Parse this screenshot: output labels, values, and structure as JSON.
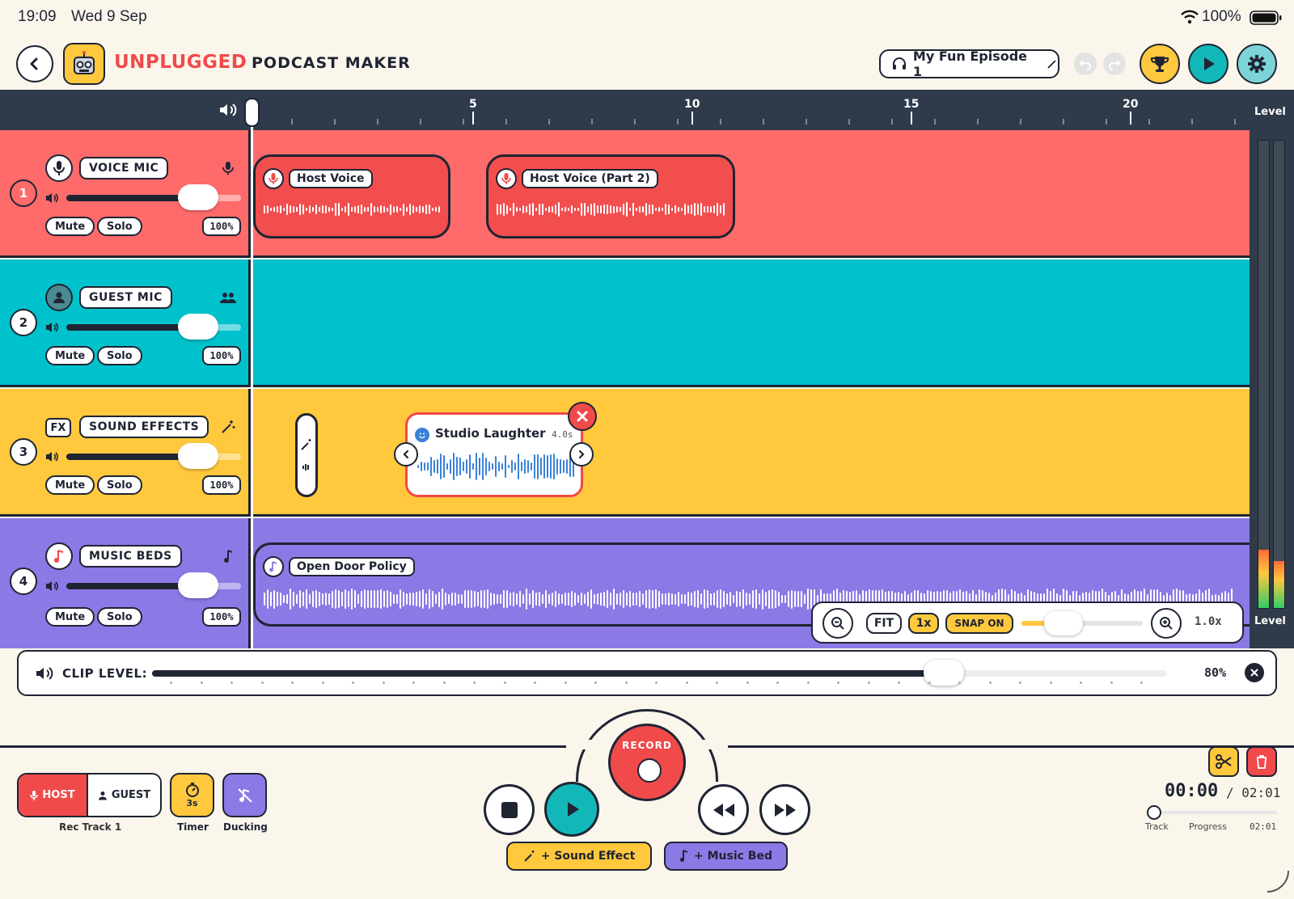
{
  "status_bar": {
    "time": "19:09",
    "date": "Wed 9 Sep",
    "battery": "100%"
  },
  "header": {
    "brand_primary": "UNPLUGGED",
    "brand_secondary": "PODCAST MAKER",
    "episode_title": "My Fun Episode 1"
  },
  "ruler": {
    "labels": [
      "5",
      "10",
      "15",
      "20"
    ]
  },
  "level_meter": {
    "top_label": "Level",
    "bottom_label": "Level"
  },
  "tracks": [
    {
      "number": "1",
      "label": "VOICE MIC",
      "mute": "Mute",
      "solo": "Solo",
      "volume": "100%",
      "color": "#ff6b6b"
    },
    {
      "number": "2",
      "label": "GUEST MIC",
      "mute": "Mute",
      "solo": "Solo",
      "volume": "100%",
      "color": "#00c2cc"
    },
    {
      "number": "3",
      "icon_text": "FX",
      "label": "SOUND EFFECTS",
      "mute": "Mute",
      "solo": "Solo",
      "volume": "100%",
      "color": "#ffc83d"
    },
    {
      "number": "4",
      "label": "MUSIC BEDS",
      "mute": "Mute",
      "solo": "Solo",
      "volume": "100%",
      "color": "#8b79e6"
    }
  ],
  "clips": {
    "host_voice": "Host Voice",
    "host_voice_2": "Host Voice (Part 2)",
    "studio_laughter": "Studio Laughter",
    "studio_laughter_duration": "4.0s",
    "open_door": "Open Door Policy"
  },
  "zoom": {
    "fit": "FIT",
    "one_x": "1x",
    "snap": "SNAP ON",
    "value": "1.0x"
  },
  "clip_level": {
    "label": "CLIP LEVEL:",
    "value": "80%",
    "fraction": 0.8
  },
  "transport": {
    "record": "RECORD",
    "host": "HOST",
    "guest": "GUEST",
    "rec_track": "Rec Track 1",
    "timer_value": "3s",
    "timer_label": "Timer",
    "ducking_label": "Ducking",
    "add_sound_effect": "+ Sound Effect",
    "add_music_bed": "+ Music Bed",
    "time_current": "00:00",
    "time_total": "/ 02:01",
    "progress_track": "Track",
    "progress_label": "Progress",
    "progress_end": "02:01"
  },
  "colors": {
    "red": "#ff6b6b",
    "teal": "#00c2cc",
    "yellow": "#ffc83d",
    "purple": "#8b79e6",
    "ink": "#1f2433"
  }
}
